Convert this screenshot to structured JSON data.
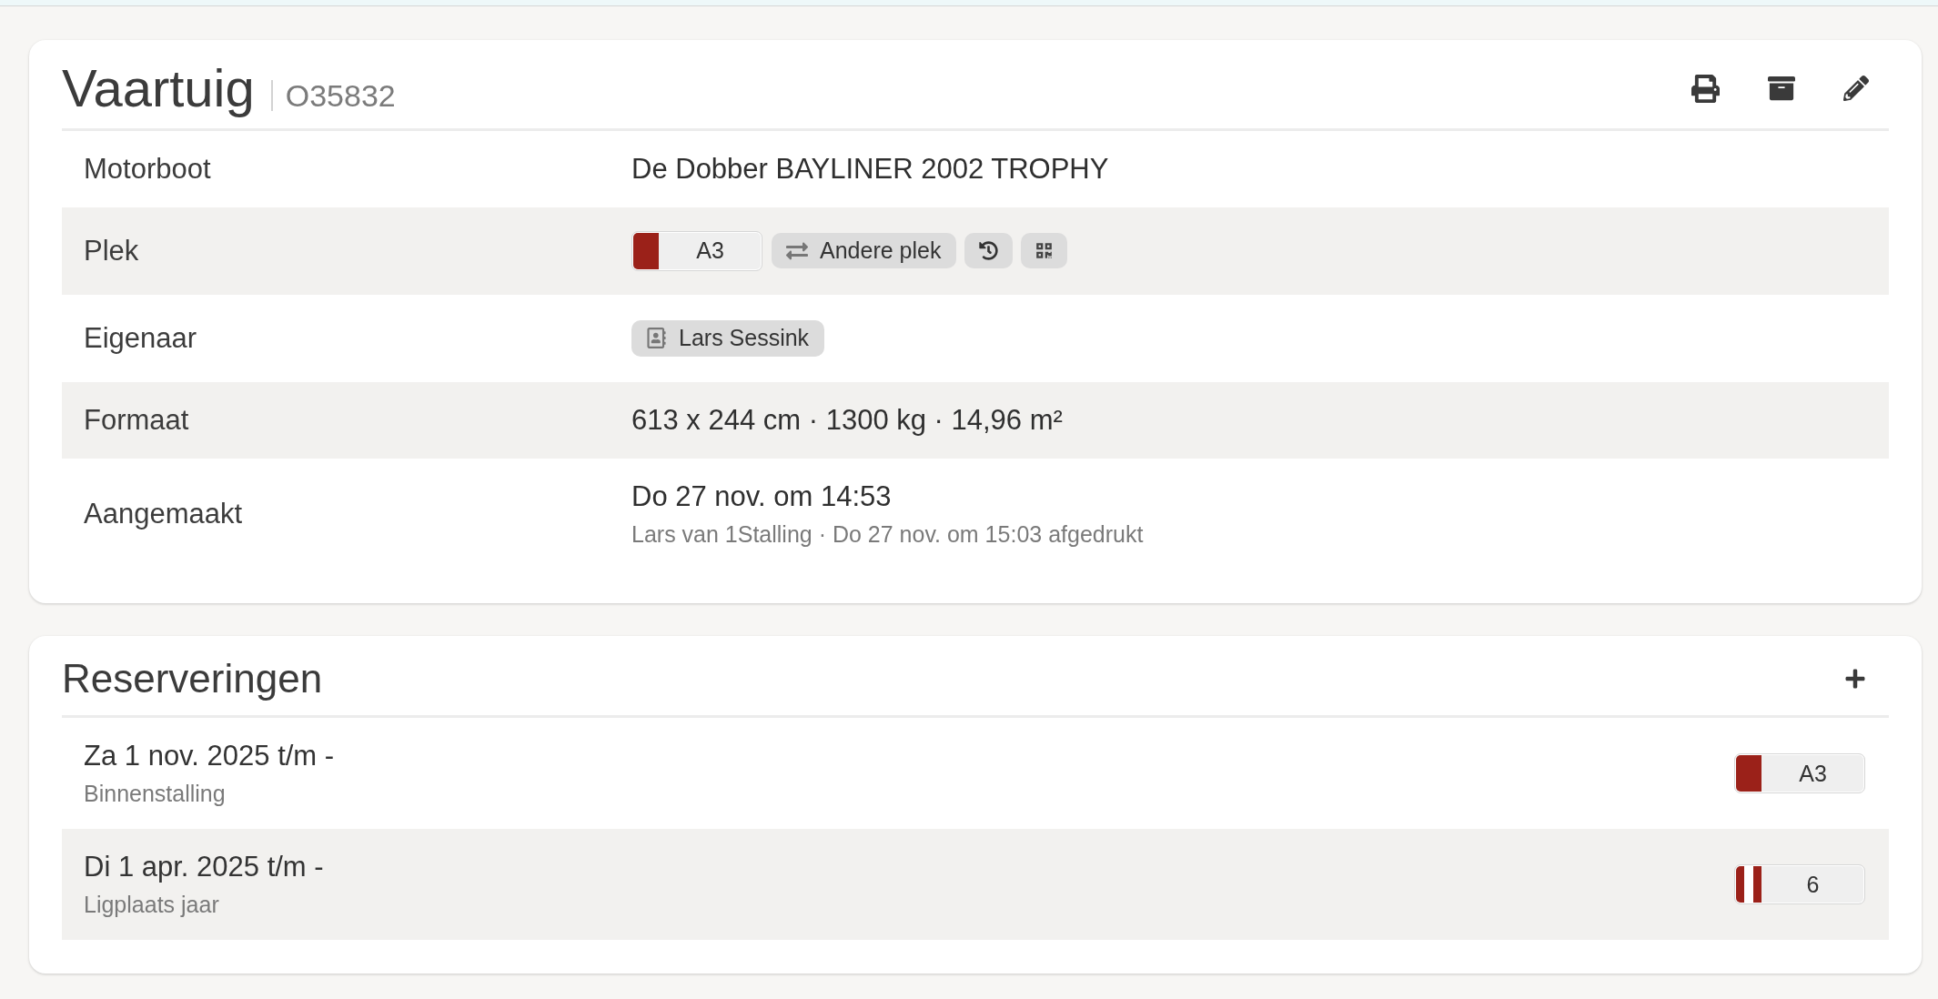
{
  "vessel": {
    "title": "Vaartuig",
    "code": "O35832",
    "details": [
      {
        "kind": "text",
        "label": "Motorboot",
        "value": "De Dobber BAYLINER 2002 TROPHY"
      },
      {
        "kind": "place",
        "label": "Plek",
        "place": {
          "code": "A3",
          "color": "#9b2119",
          "kind": "solid"
        },
        "button": "Andere plek"
      },
      {
        "kind": "contact",
        "label": "Eigenaar",
        "value": "Lars Sessink"
      },
      {
        "kind": "text",
        "label": "Formaat",
        "value": "613 x 244 cm · 1300 kg · 14,96 m²"
      },
      {
        "kind": "created",
        "label": "Aangemaakt",
        "value": "Do 27 nov. om 14:53",
        "note": "Lars van 1Stalling · Do 27 nov. om 15:03 afgedrukt"
      }
    ]
  },
  "reservations": {
    "title": "Reserveringen",
    "items": [
      {
        "period": "Za 1 nov. 2025 t/m -",
        "type": "Binnenstalling",
        "place": {
          "code": "A3",
          "color": "#9b2119",
          "kind": "solid"
        }
      },
      {
        "period": "Di 1 apr. 2025 t/m -",
        "type": "Ligplaats jaar",
        "place": {
          "code": "6",
          "color": "#9b2119",
          "kind": "striped"
        }
      }
    ]
  }
}
